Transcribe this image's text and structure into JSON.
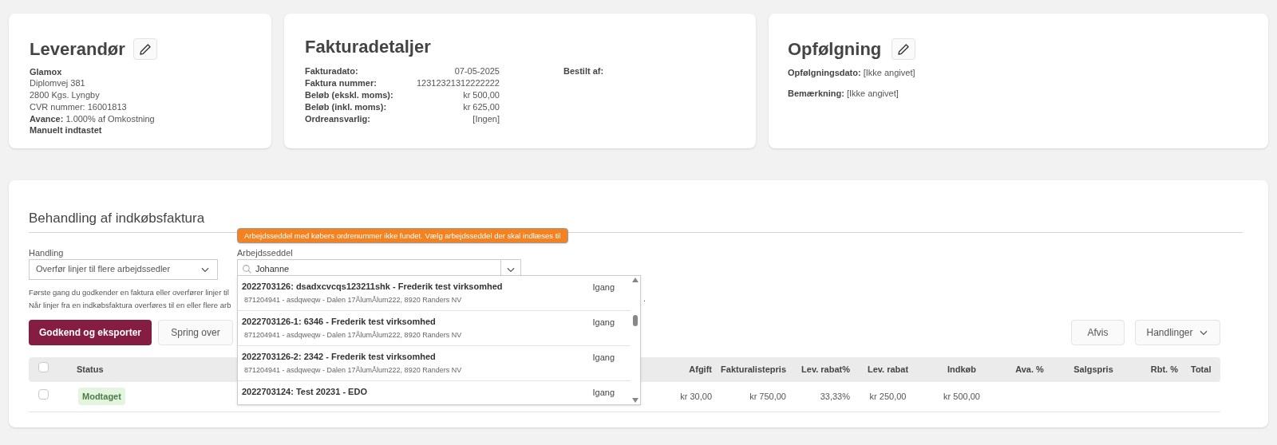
{
  "supplier": {
    "title": "Leverandør",
    "name": "Glamox",
    "lines": [
      "Diplomvej 381",
      "2800 Kgs. Lyngby",
      "CVR nummer: 16001813"
    ],
    "markup_label": "Avance:",
    "markup_value": "1.000% af Omkostning",
    "source": "Manuelt indtastet"
  },
  "invoice_details": {
    "title": "Fakturadetaljer",
    "fields": [
      {
        "label": "Fakturadato:",
        "value": "07-05-2025"
      },
      {
        "label": "Faktura nummer:",
        "value": "12312321312222222"
      },
      {
        "label": "Beløb (ekskl. moms):",
        "value": "kr 500,00"
      },
      {
        "label": "Beløb (inkl. moms):",
        "value": "kr 625,00"
      },
      {
        "label": "Ordreansvarlig:",
        "value": "[Ingen]"
      }
    ],
    "ordered_by_label": "Bestilt af:"
  },
  "follow_up": {
    "title": "Opfølgning",
    "fields": [
      {
        "label": "Opfølgningsdato:",
        "value": "[Ikke angivet]"
      },
      {
        "label": "Bemærkning:",
        "value": "[Ikke angivet]"
      }
    ]
  },
  "processing": {
    "title": "Behandling af indkøbsfaktura",
    "action_label": "Handling",
    "action_value": "Overfør linjer til flere arbejdssedler",
    "worksheet_label": "Arbejdsseddel",
    "worksheet_search": "Johanne",
    "tooltip": "Arbejdsseddel med købers ordrenummer ikke fundet. Vælg arbejdsseddel der skal indlæses til",
    "info_lines": [
      "Første gang du godkender en faktura eller overfører linjer til",
      "Når linjer fra en indkøbsfaktura overføres til en eller flere arb"
    ],
    "info_tail": ".",
    "options": [
      {
        "title": "2022703126: dsadxcvcqs123211shk - Frederik test virksomhed",
        "detail": "871204941 - asdqweqw - Dalen 17ÅlumÅlum222, 8920 Randers NV",
        "status": "Igang"
      },
      {
        "title": "2022703126-1: 6346 - Frederik test virksomhed",
        "detail": "871204941 - asdqweqw - Dalen 17ÅlumÅlum222, 8920 Randers NV",
        "status": "Igang"
      },
      {
        "title": "2022703126-2: 2342 - Frederik test virksomhed",
        "detail": "871204941 - asdqweqw - Dalen 17ÅlumÅlum222, 8920 Randers NV",
        "status": "Igang"
      },
      {
        "title": "2022703124: Test 20231 - EDO",
        "status": "Igang"
      }
    ],
    "buttons": {
      "approve": "Godkend og eksporter",
      "skip": "Spring over",
      "reject": "Afvis",
      "actions": "Handlinger"
    }
  },
  "table": {
    "columns": [
      "Status",
      "Afgift",
      "Fakturalistepris",
      "Lev. rabat%",
      "Lev. rabat",
      "Indkøb",
      "Ava. %",
      "Salgspris",
      "Rbt. %",
      "Total"
    ],
    "header_checked": false,
    "rows": [
      {
        "checked": false,
        "cells": [
          "Modtaget",
          "kr 30,00",
          "kr 750,00",
          "33,33%",
          "kr 250,00",
          "kr 500,00",
          "",
          "",
          "",
          ""
        ]
      }
    ]
  }
}
